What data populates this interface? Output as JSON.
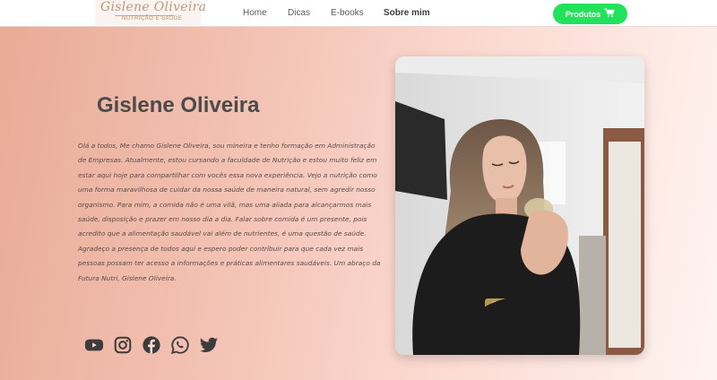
{
  "logo": {
    "script": "Gislene Oliveira",
    "tagline": "NUTRIÇÃO E SAÚDE"
  },
  "nav": {
    "items": [
      "Home",
      "Dicas",
      "E-books",
      "Sobre mim"
    ],
    "active": "Sobre mim"
  },
  "cta": {
    "label": "Produtos",
    "icon": "cart-icon",
    "color": "#22e15a"
  },
  "hero": {
    "name": "Gislene Oliveira",
    "bio": "Olá a todos,  Me chamo Gislene Oliveira, sou mineira e tenho formação em Administração de Empresas. Atualmente, estou cursando a faculdade de Nutrição e estou muito feliz em estar aqui hoje para compartilhar com vocês essa nova experiência. Vejo a nutrição como uma forma maravilhosa de cuidar da nossa saúde de maneira natural, sem agredir nosso organismo. Para mim, a comida não é uma vilã, mas uma aliada para alcançarmos mais saúde, disposição e prazer em nosso dia a dia. Falar sobre comida é um presente, pois acredito que a alimentação saudável vai além de nutrientes, é uma questão de saúde. Agradeço a presença de todos aqui e espero poder contribuir para que cada vez mais pessoas possam ter acesso a informações e práticas alimentares saudáveis. Um abraço da Futura Nutri, Gislene Oliveira."
  },
  "socials": [
    "youtube-icon",
    "instagram-icon",
    "facebook-icon",
    "whatsapp-icon",
    "twitter-icon"
  ],
  "colors": {
    "accent": "#22e15a",
    "name_text": "#4b4b4b",
    "icon": "#3c3c3c"
  }
}
